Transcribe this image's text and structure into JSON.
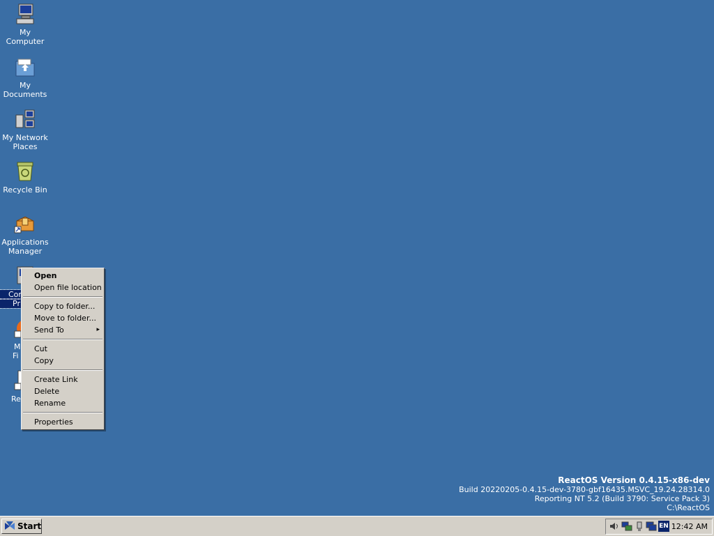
{
  "desktop": {
    "background_color": "#3a6ea5",
    "icons": [
      {
        "name": "computer-icon",
        "label_line1": "My",
        "label_line2": "Computer"
      },
      {
        "name": "documents-icon",
        "label_line1": "My",
        "label_line2": "Documents"
      },
      {
        "name": "network-icon",
        "label_line1": "My Network",
        "label_line2": "Places"
      },
      {
        "name": "recycle-bin-icon",
        "label_line1": "Recycle Bin",
        "label_line2": ""
      },
      {
        "name": "package-icon",
        "label_line1": "Applications",
        "label_line2": "Manager"
      },
      {
        "name": "control-panel-icon",
        "label_line1": "Con",
        "label_line2": "Pr"
      },
      {
        "name": "firefox-icon",
        "label_line1": "M",
        "label_line2": "Fi"
      },
      {
        "name": "readme-icon",
        "label_line1": "Re",
        "label_line2": ""
      }
    ]
  },
  "context_menu": {
    "items": [
      {
        "label": "Open",
        "bold": true
      },
      {
        "label": "Open file location"
      },
      {
        "separator": true
      },
      {
        "label": "Copy to folder..."
      },
      {
        "label": "Move to folder..."
      },
      {
        "label": "Send To",
        "submenu": true
      },
      {
        "separator": true
      },
      {
        "label": "Cut"
      },
      {
        "label": "Copy"
      },
      {
        "separator": true
      },
      {
        "label": "Create Link"
      },
      {
        "label": "Delete"
      },
      {
        "label": "Rename"
      },
      {
        "separator": true
      },
      {
        "label": "Properties"
      }
    ],
    "submenu_arrow": "▸"
  },
  "version_info": {
    "title": "ReactOS Version 0.4.15-x86-dev",
    "build": "Build 20220205-0.4.15-dev-3780-gbf16435.MSVC_19.24.28314.0",
    "reporting": "Reporting NT 5.2 (Build 3790: Service Pack 3)",
    "path": "C:\\ReactOS"
  },
  "taskbar": {
    "start_label": "Start",
    "tray": {
      "icons": [
        "volume-icon",
        "network-tray-icon",
        "usb-icon",
        "display-icon"
      ],
      "language": "EN",
      "clock": "12:42 AM"
    }
  }
}
